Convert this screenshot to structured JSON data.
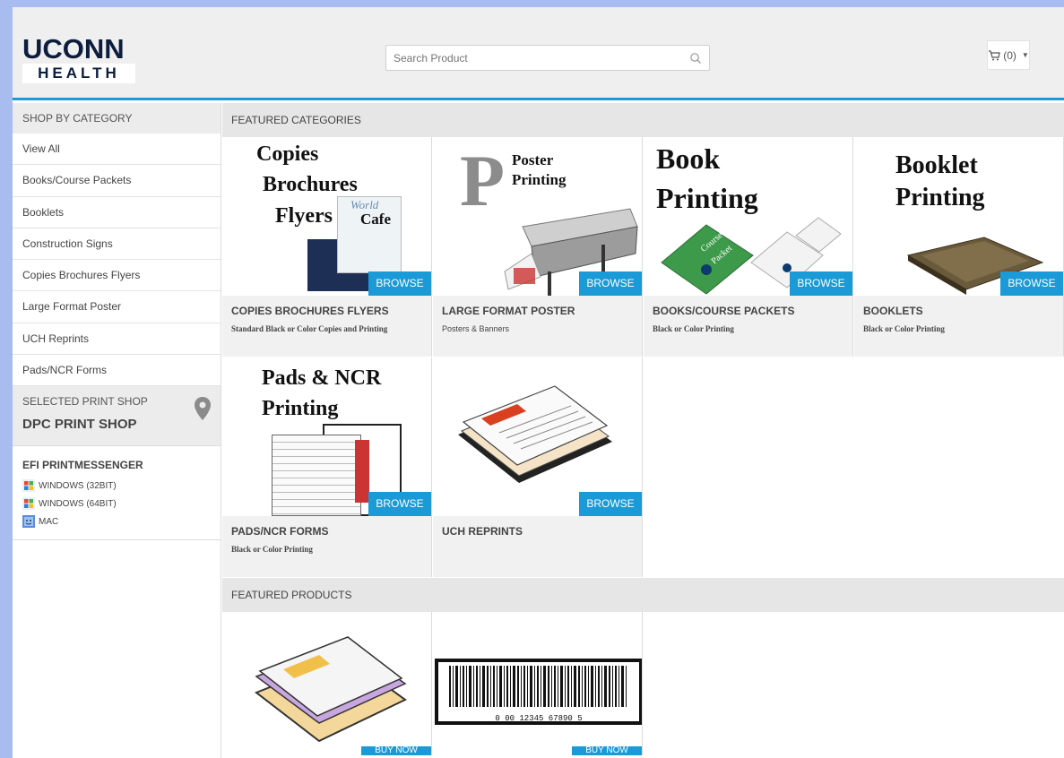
{
  "brand": {
    "line1": "UCONN",
    "line2": "HEALTH"
  },
  "search": {
    "placeholder": "Search Product"
  },
  "cart": {
    "label": "(0)"
  },
  "colors": {
    "accent": "#1a9ad6",
    "page_bg": "#a9bcef",
    "header_bg": "#efefef"
  },
  "sidebar": {
    "heading": "SHOP BY CATEGORY",
    "items": [
      {
        "label": "View All"
      },
      {
        "label": "Books/Course Packets"
      },
      {
        "label": "Booklets"
      },
      {
        "label": "Construction Signs"
      },
      {
        "label": "Copies Brochures Flyers"
      },
      {
        "label": "Large Format Poster"
      },
      {
        "label": "UCH Reprints"
      },
      {
        "label": "Pads/NCR Forms"
      }
    ],
    "shop": {
      "label": "SELECTED PRINT SHOP",
      "name": "DPC PRINT SHOP"
    },
    "efi": {
      "title": "EFI PRINTMESSENGER",
      "downloads": [
        {
          "label": "WINDOWS (32BIT)",
          "icon": "windows-icon"
        },
        {
          "label": "WINDOWS (64BIT)",
          "icon": "windows-icon"
        },
        {
          "label": "MAC",
          "icon": "mac-icon"
        }
      ]
    }
  },
  "featured_categories": {
    "heading": "FEATURED CATEGORIES",
    "browse_label": "BROWSE",
    "cards": [
      {
        "title": "COPIES BROCHURES FLYERS",
        "subtitle": "Standard Black or Color Copies and Printing",
        "img_text": [
          "Copies",
          "Brochures",
          "Flyers"
        ],
        "mini_text": [
          "World",
          "Cafe"
        ]
      },
      {
        "title": "LARGE FORMAT POSTER",
        "subtitle": "Posters & Banners",
        "img_text": [
          "P",
          "Poster",
          "Printing"
        ]
      },
      {
        "title": "BOOKS/COURSE PACKETS",
        "subtitle": "Black or Color Printing",
        "img_text": [
          "Book",
          "Printing"
        ],
        "mini_text": [
          "Course",
          "Packet"
        ]
      },
      {
        "title": "BOOKLETS",
        "subtitle": "Black or Color Printing",
        "img_text": [
          "Booklet",
          "Printing"
        ]
      },
      {
        "title": "PADS/NCR FORMS",
        "subtitle": "Black or Color Printing",
        "img_text": [
          "Pads & NCR",
          "Printing"
        ]
      },
      {
        "title": "UCH REPRINTS",
        "subtitle": ""
      }
    ]
  },
  "featured_products": {
    "heading": "FEATURED PRODUCTS",
    "buy_label": "BUY NOW",
    "barcode_text": "0 00 12345 67890 5"
  }
}
